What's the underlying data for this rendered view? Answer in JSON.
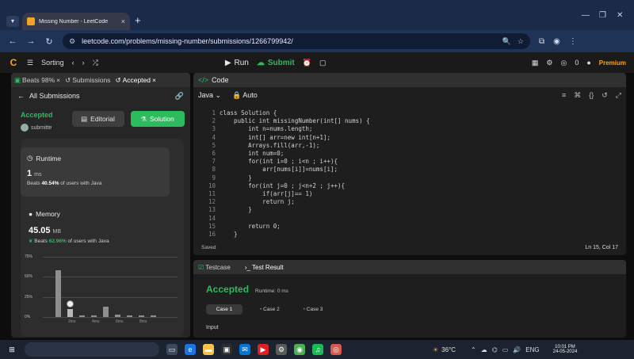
{
  "browser": {
    "tab_title": "Missing Number - LeetCode",
    "new_tab": "+",
    "url": "leetcode.com/problems/missing-number/submissions/1266799942/"
  },
  "lc_toolbar": {
    "problem_list": "Sorting",
    "run": "Run",
    "submit": "Submit",
    "coins": "0",
    "premium": "Premium"
  },
  "left_panel": {
    "tabs": [
      {
        "label": "Beats 98%"
      },
      {
        "label": "Submissions"
      },
      {
        "label": "Accepted"
      }
    ],
    "back_label": "All Submissions",
    "status": "Accepted",
    "user": "submitte",
    "editorial": "Editorial",
    "solution": "Solution",
    "runtime": {
      "title": "Runtime",
      "value": "1",
      "unit": "ms",
      "beats_prefix": "Beats",
      "beats_pct": "40.54%",
      "beats_suffix": "of users with Java"
    },
    "memory": {
      "title": "Memory",
      "value": "45.05",
      "unit": "MB",
      "beats_prefix": "Beats",
      "beats_pct": "62.96%",
      "beats_suffix": "of users with Java"
    }
  },
  "chart_data": {
    "type": "bar",
    "yticks": [
      "75%",
      "50%",
      "25%",
      "0%"
    ],
    "ylim": [
      0,
      75
    ],
    "xticks": [
      "2ms",
      "4ms",
      "6ms",
      "8ms"
    ],
    "values": [
      58,
      10,
      2,
      2,
      13,
      3,
      2,
      2,
      2
    ],
    "highlight_index": 1
  },
  "code_panel": {
    "title": "Code",
    "language": "Java",
    "mode": "Auto",
    "lines": [
      "class Solution {",
      "    public int missingNumber(int[] nums) {",
      "        int n=nums.length;",
      "        int[] arr=new int[n+1];",
      "        Arrays.fill(arr,-1);",
      "        int num=0;",
      "        for(int i=0 ; i<n ; i++){",
      "            arr[nums[i]]=nums[i];",
      "        }",
      "        for(int j=0 ; j<n+2 ; j++){",
      "            if(arr[j]== 1)",
      "            return j;",
      "        }",
      "",
      "        return 0;",
      "    }"
    ],
    "saved": "Saved",
    "cursor": "Ln 15, Col 17"
  },
  "bottom_panel": {
    "tabs": [
      "Testcase",
      "Test Result"
    ],
    "status": "Accepted",
    "runtime": "Runtime: 0 ms",
    "cases": [
      "Case 1",
      "Case 2",
      "Case 3"
    ],
    "input_label": "Input"
  },
  "taskbar": {
    "temperature": "36°C",
    "lang": "ENG",
    "time": "10:01 PM",
    "date": "24-05-2024"
  },
  "colors": {
    "accepted": "#2cbb5d",
    "leetcode_orange": "#ffa116"
  }
}
